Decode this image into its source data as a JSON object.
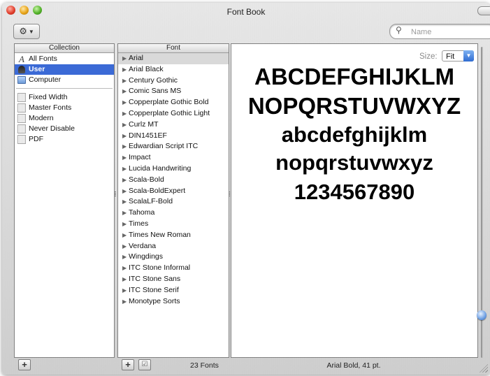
{
  "window": {
    "title": "Font Book"
  },
  "toolbar": {
    "action_icon": "gear-icon",
    "search": {
      "placeholder": "Name",
      "value": ""
    }
  },
  "collections": {
    "header": "Collection",
    "items": [
      {
        "label": "All Fonts",
        "icon": "all-fonts-icon"
      },
      {
        "label": "User",
        "icon": "user-icon",
        "selected": true
      },
      {
        "label": "Computer",
        "icon": "computer-icon"
      }
    ],
    "library_items": [
      {
        "label": "Fixed Width",
        "icon": "collection-icon"
      },
      {
        "label": "Master Fonts",
        "icon": "collection-icon"
      },
      {
        "label": "Modern",
        "icon": "collection-icon"
      },
      {
        "label": "Never Disable",
        "icon": "collection-icon"
      },
      {
        "label": "PDF",
        "icon": "collection-icon"
      }
    ]
  },
  "fonts": {
    "header": "Font",
    "items": [
      "Arial",
      "Arial Black",
      "Century Gothic",
      "Comic Sans MS",
      "Copperplate Gothic Bold",
      "Copperplate Gothic Light",
      "Curlz MT",
      "DIN1451EF",
      "Edwardian Script ITC",
      "Impact",
      "Lucida Handwriting",
      "Scala-Bold",
      "Scala-BoldExpert",
      "ScalaLF-Bold",
      "Tahoma",
      "Times",
      "Times New Roman",
      "Verdana",
      "Wingdings",
      "ITC Stone Informal",
      "ITC Stone Sans",
      "ITC Stone Serif",
      "Monotype Sorts"
    ],
    "selected_index": 0
  },
  "preview": {
    "size_label": "Size:",
    "size_value": "Fit",
    "sample_lines": [
      "ABCDEFGHIJKLM",
      "NOPQRSTUVWXYZ",
      "abcdefghijklm",
      "nopqrstuvwxyz",
      "1234567890"
    ],
    "slider_level": 0.85
  },
  "footer": {
    "add_collection_label": "+",
    "add_font_label": "+",
    "enable_font_label": "☑",
    "font_count": "23 Fonts",
    "status": "Arial Bold, 41 pt."
  },
  "colors": {
    "selection": "#3b6ad6",
    "font_selection": "#d9d9d9"
  }
}
